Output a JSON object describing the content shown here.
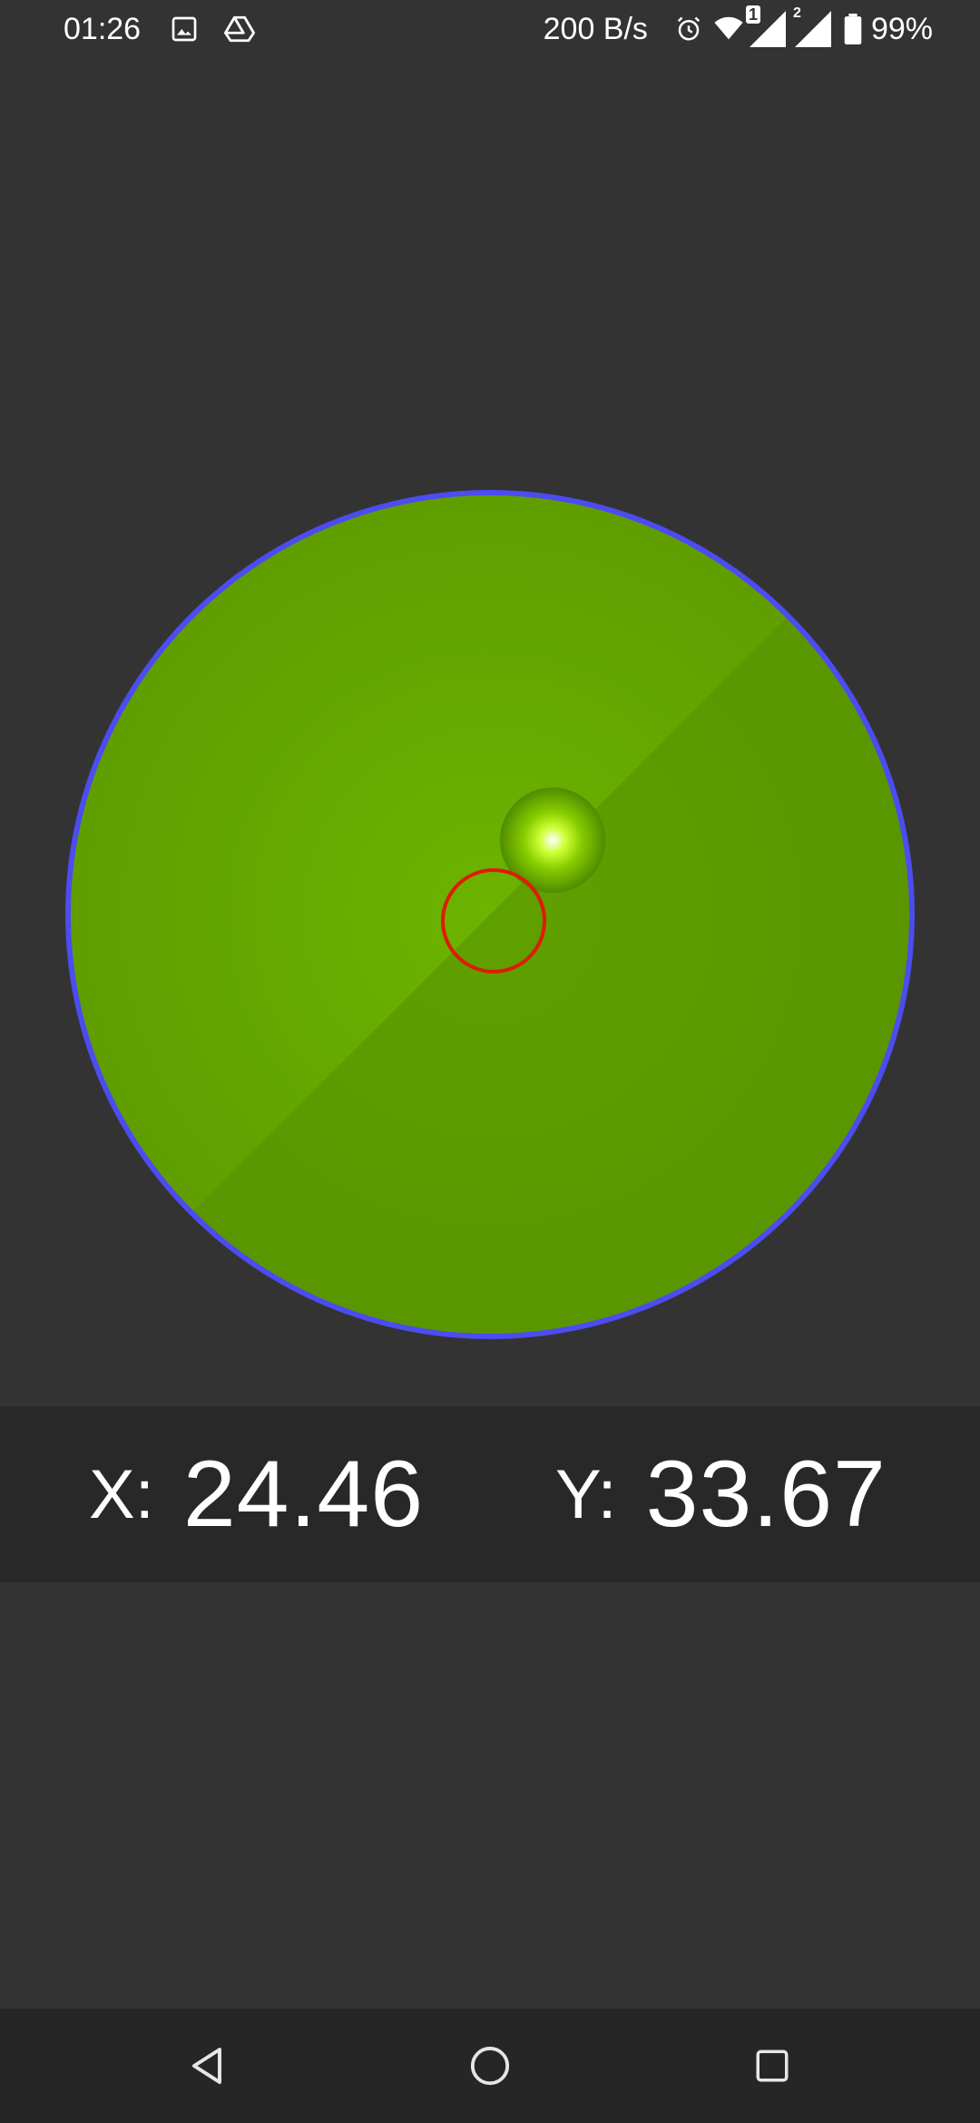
{
  "status_bar": {
    "time": "01:26",
    "network_speed": "200 B/s",
    "battery_percent": "99%",
    "sim1_label": "1",
    "sim2_label": "2",
    "icons": [
      "image-icon",
      "drive-icon",
      "alarm-icon",
      "wifi-icon",
      "signal-icon",
      "signal-icon",
      "battery-icon"
    ]
  },
  "level": {
    "colors": {
      "ring": "#4c4cf0",
      "surface": "#62a400",
      "surface_dark": "#5a9400",
      "bubble_center": "#ffffff",
      "bubble_mid": "#aaff00",
      "bubble_edge": "#4f8c00",
      "target_ring": "#e01a00"
    }
  },
  "readout": {
    "x_label": "X:",
    "x_value": "24.46",
    "y_label": "Y:",
    "y_value": "33.67"
  },
  "nav_bar": {
    "icons": [
      "back-icon",
      "home-icon",
      "recents-icon"
    ]
  },
  "theme": {
    "background": "#333333",
    "panel": "#282828",
    "nav_background": "#262626",
    "text": "#ffffff"
  }
}
